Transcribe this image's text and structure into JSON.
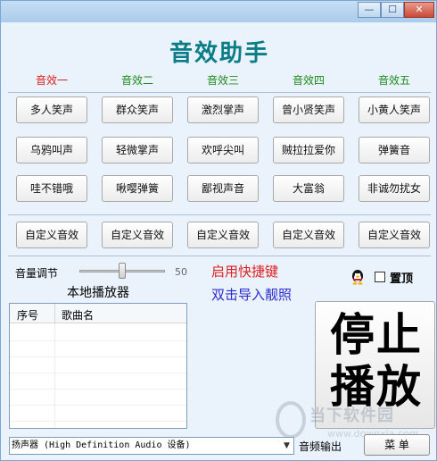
{
  "window": {
    "title": "音效助手",
    "controls": {
      "minimize": "—",
      "maximize": "☐",
      "close": "✕"
    }
  },
  "columns": [
    {
      "label": "音效一",
      "color": "#d81e1e"
    },
    {
      "label": "音效二",
      "color": "#1e8a1e"
    },
    {
      "label": "音效三",
      "color": "#1e8a1e"
    },
    {
      "label": "音效四",
      "color": "#1e8a1e"
    },
    {
      "label": "音效五",
      "color": "#1e8a1e"
    }
  ],
  "effects": [
    [
      "多人笑声",
      "群众笑声",
      "激烈掌声",
      "曾小贤笑声",
      "小黄人笑声"
    ],
    [
      "乌鸦叫声",
      "轻微掌声",
      "欢呼尖叫",
      "贼拉拉爱你",
      "弹簧音"
    ],
    [
      "哇不错哦",
      "啾嘤弹簧",
      "鄙视声音",
      "大富翁",
      "非诚勿扰女"
    ]
  ],
  "custom": [
    "自定义音效",
    "自定义音效",
    "自定义音效",
    "自定义音效",
    "自定义音效"
  ],
  "volume": {
    "label": "音量调节",
    "value": "50",
    "level": 0.5
  },
  "hotkey_label": "启用快捷键",
  "import_label": "双击导入靓照",
  "on_top": {
    "label": "置顶",
    "checked": false,
    "icon": "qq-penguin-icon"
  },
  "player": {
    "title": "本地播放器",
    "headers": [
      "序号",
      "歌曲名"
    ],
    "rows": []
  },
  "stop_button": {
    "line1": "停止",
    "line2": "播放"
  },
  "watermark": {
    "text": "当下软件园",
    "url": "www.downxia.com"
  },
  "device": {
    "selected": "扬声器 (High Definition Audio 设备)"
  },
  "audio_output_label": "音频输出",
  "menu_label": "菜 单"
}
